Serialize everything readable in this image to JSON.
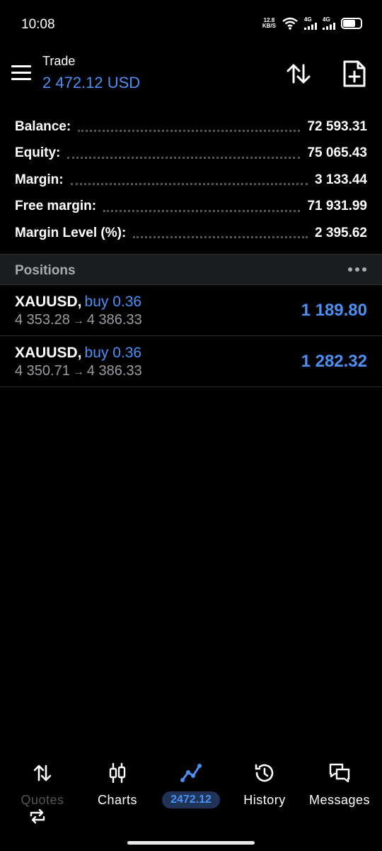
{
  "status_bar": {
    "time": "10:08",
    "net_speed_value": "12.8",
    "net_speed_unit": "KB/S",
    "sim1_label": "4G",
    "sim2_label": "4G",
    "battery_level": 0.7
  },
  "header": {
    "title": "Trade",
    "subtitle": "2 472.12 USD"
  },
  "summary": [
    {
      "label": "Balance:",
      "value": "72 593.31"
    },
    {
      "label": "Equity:",
      "value": "75 065.43"
    },
    {
      "label": "Margin:",
      "value": "3 133.44"
    },
    {
      "label": "Free margin:",
      "value": "71 931.99"
    },
    {
      "label": "Margin Level (%):",
      "value": "2 395.62"
    }
  ],
  "positions": {
    "header": "Positions",
    "items": [
      {
        "symbol": "XAUUSD,",
        "side": "buy 0.36",
        "open": "4 353.28",
        "arrow": "→",
        "current": "4 386.33",
        "profit": "1 189.80"
      },
      {
        "symbol": "XAUUSD,",
        "side": "buy 0.36",
        "open": "4 350.71",
        "arrow": "→",
        "current": "4 386.33",
        "profit": "1 282.32"
      }
    ]
  },
  "bottom_nav": {
    "items": [
      {
        "label": "Quotes",
        "icon": "sort-arrows-icon"
      },
      {
        "label": "Charts",
        "icon": "candlestick-icon"
      },
      {
        "label": "2472.12",
        "icon": "trend-line-icon"
      },
      {
        "label": "History",
        "icon": "history-icon"
      },
      {
        "label": "Messages",
        "icon": "messages-icon"
      }
    ]
  },
  "colors": {
    "accent": "#4a90f5",
    "background": "#000000",
    "section_header": "#1c1d21",
    "muted_text": "#9a9ca1"
  }
}
